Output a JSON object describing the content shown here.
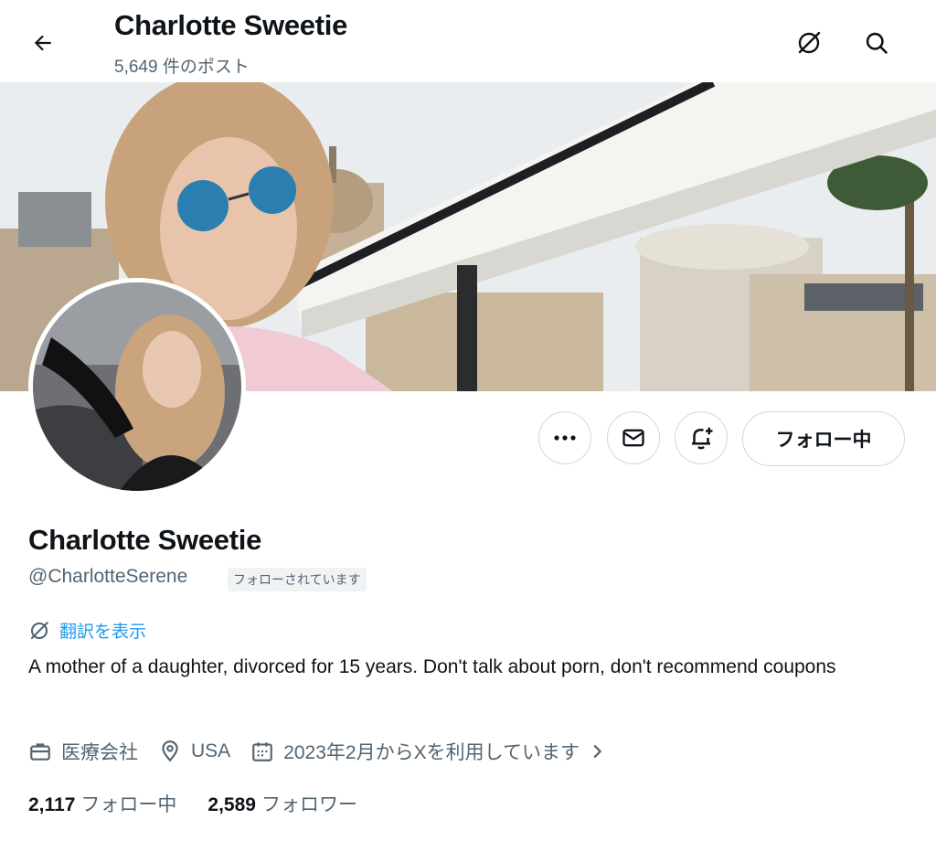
{
  "header": {
    "title": "Charlotte Sweetie",
    "post_count": "5,649 件のポスト"
  },
  "actions": {
    "more_label": "…",
    "follow_label": "フォロー中"
  },
  "profile": {
    "name": "Charlotte Sweetie",
    "handle": "@CharlotteSerene",
    "follows_you": "フォローされています",
    "translate_label": "翻訳を表示",
    "bio": "A mother of a daughter, divorced for 15 years. Don't talk about porn, don't recommend coupons",
    "category": "医療会社",
    "location": "USA",
    "joined": "2023年2月からXを利用しています"
  },
  "stats": {
    "following_count": "2,117",
    "following_label": "フォロー中",
    "followers_count": "2,589",
    "followers_label": "フォロワー"
  },
  "colors": {
    "accent": "#1d9bf0",
    "secondary_text": "#536471",
    "border": "#cfd9de"
  }
}
